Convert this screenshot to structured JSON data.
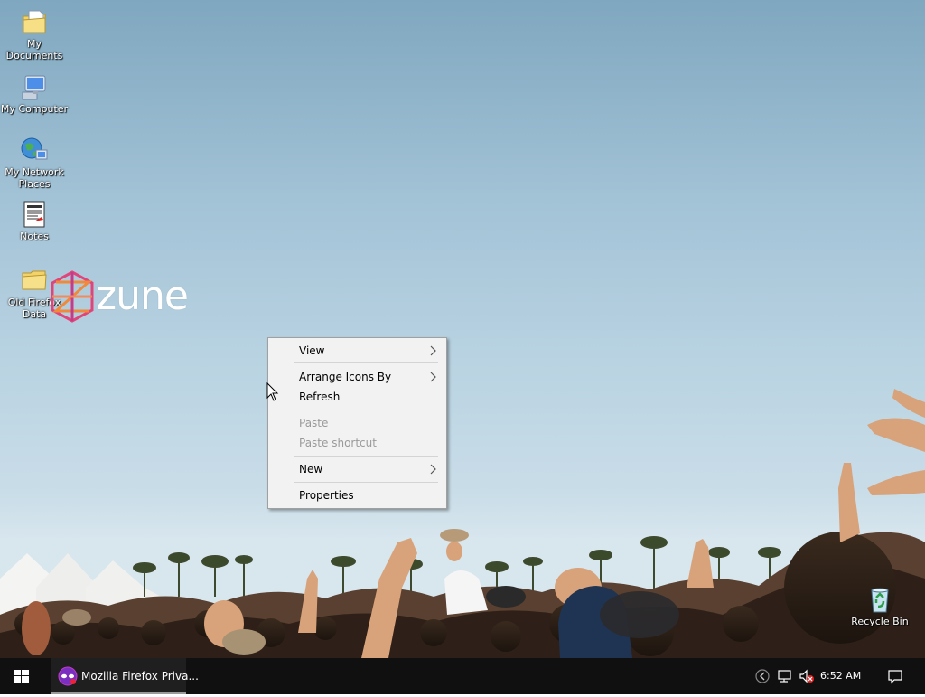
{
  "desktop": {
    "icons": [
      {
        "label": "My Documents",
        "icon": "my-documents-icon"
      },
      {
        "label": "My Computer",
        "icon": "my-computer-icon"
      },
      {
        "label": "My Network Places",
        "icon": "network-places-icon"
      },
      {
        "label": "Notes",
        "icon": "notes-document-icon"
      },
      {
        "label": "Old Firefox Data",
        "icon": "folder-icon"
      },
      {
        "label": "Recycle Bin",
        "icon": "recycle-bin-icon"
      }
    ],
    "wallpaper_logo": "zune"
  },
  "context_menu": {
    "items": [
      {
        "label": "View",
        "enabled": true,
        "submenu": true
      },
      {
        "label": "Arrange Icons By",
        "enabled": true,
        "submenu": true
      },
      {
        "label": "Refresh",
        "enabled": true,
        "submenu": false
      },
      {
        "label": "Paste",
        "enabled": false,
        "submenu": false
      },
      {
        "label": "Paste shortcut",
        "enabled": false,
        "submenu": false
      },
      {
        "label": "New",
        "enabled": true,
        "submenu": true
      },
      {
        "label": "Properties",
        "enabled": true,
        "submenu": false
      }
    ]
  },
  "taskbar": {
    "start_icon": "windows-logo-icon",
    "tasks": [
      {
        "label": "Mozilla Firefox Priva...",
        "icon": "firefox-private-icon"
      }
    ],
    "tray": {
      "icons": [
        "show-hidden-icons-chevron-icon",
        "network-icon",
        "volume-muted-icon"
      ],
      "clock": "6:52 AM",
      "notification_icon": "action-center-icon"
    }
  },
  "colors": {
    "taskbar_bg": "#101010",
    "menu_bg": "#f2f2f2",
    "menu_disabled_text": "#9a9a9a",
    "private_browsing_purple": "#7b2fbf"
  }
}
